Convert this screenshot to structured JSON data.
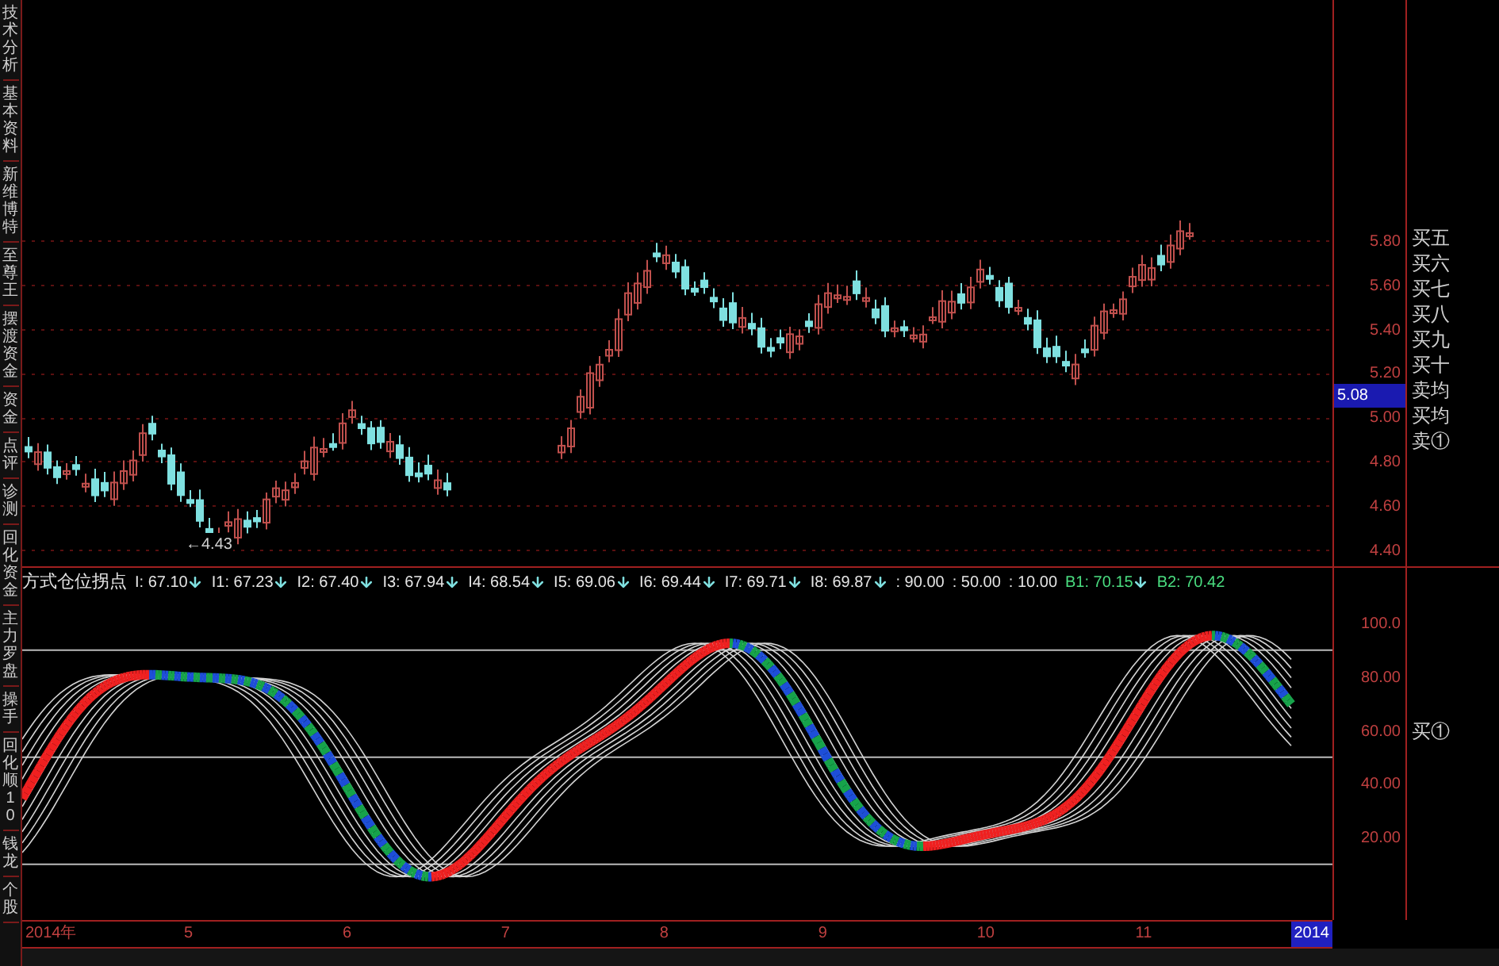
{
  "side_tabs": [
    {
      "label": "技术分析"
    },
    {
      "label": "基本资料"
    },
    {
      "label": "新维博特"
    },
    {
      "label": "至尊王"
    },
    {
      "label": "摆渡资金"
    },
    {
      "label": "资金"
    },
    {
      "label": "点评"
    },
    {
      "label": "诊测"
    },
    {
      "label": "回化资金"
    },
    {
      "label": "主力罗盘"
    },
    {
      "label": "操手"
    },
    {
      "label": "回化顺10"
    },
    {
      "label": "钱龙"
    },
    {
      "label": "个股"
    }
  ],
  "price_chart": {
    "low_marker": "←4.43",
    "axis_ticks": [
      "5.80",
      "5.60",
      "5.40",
      "5.20",
      "5.00",
      "4.80",
      "4.60",
      "4.40"
    ],
    "current_price": "5.08",
    "order_labels": [
      "买五",
      "买六",
      "买七",
      "买八",
      "买九",
      "买十",
      "卖均",
      "买均",
      "卖①"
    ]
  },
  "indicator": {
    "name": "方式仓位拐点",
    "values": [
      {
        "text": "I: 67.10",
        "down": true,
        "color": "#e5e5e5"
      },
      {
        "text": "I1: 67.23",
        "down": true,
        "color": "#e5e5e5"
      },
      {
        "text": "I2: 67.40",
        "down": true,
        "color": "#e5e5e5"
      },
      {
        "text": "I3: 67.94",
        "down": true,
        "color": "#e5e5e5"
      },
      {
        "text": "I4: 68.54",
        "down": true,
        "color": "#e5e5e5"
      },
      {
        "text": "I5: 69.06",
        "down": true,
        "color": "#e5e5e5"
      },
      {
        "text": "I6: 69.44",
        "down": true,
        "color": "#e5e5e5"
      },
      {
        "text": "I7: 69.71",
        "down": true,
        "color": "#e5e5e5"
      },
      {
        "text": "I8: 69.87",
        "down": true,
        "color": "#e5e5e5"
      },
      {
        "text": ": 90.00",
        "down": false,
        "color": "#e5e5e5"
      },
      {
        "text": ": 50.00",
        "down": false,
        "color": "#e5e5e5"
      },
      {
        "text": ": 10.00",
        "down": false,
        "color": "#e5e5e5"
      },
      {
        "text": "B1: 70.15",
        "down": true,
        "color": "#4ade80"
      },
      {
        "text": "B2: 70.42",
        "down": false,
        "color": "#4ade80"
      }
    ],
    "axis_ticks": [
      "100.0",
      "80.00",
      "60.00",
      "40.00",
      "20.00"
    ],
    "side_label": "买①"
  },
  "date_axis": [
    {
      "label": "2014年",
      "selected": false
    },
    {
      "label": "5",
      "selected": false
    },
    {
      "label": "6",
      "selected": false
    },
    {
      "label": "7",
      "selected": false
    },
    {
      "label": "8",
      "selected": false
    },
    {
      "label": "9",
      "selected": false
    },
    {
      "label": "10",
      "selected": false
    },
    {
      "label": "11",
      "selected": false
    },
    {
      "label": "2014",
      "selected": true
    }
  ]
}
